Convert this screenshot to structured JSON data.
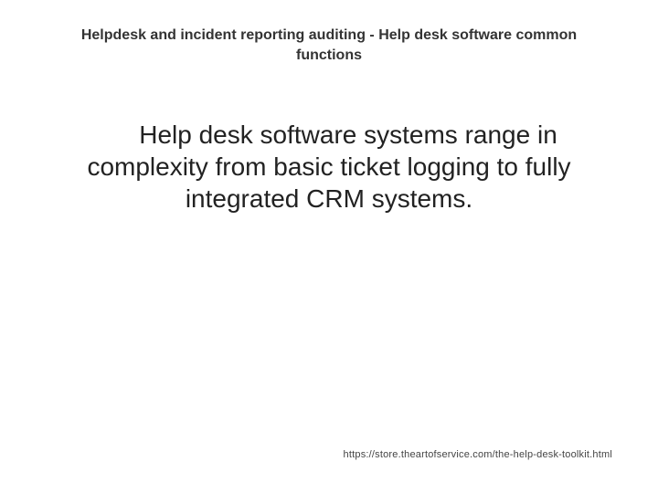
{
  "slide": {
    "title": "Helpdesk and incident reporting auditing - Help desk software common functions",
    "body": "Help desk software systems range in complexity from basic ticket logging to fully integrated CRM systems.",
    "footer_url": "https://store.theartofservice.com/the-help-desk-toolkit.html"
  }
}
